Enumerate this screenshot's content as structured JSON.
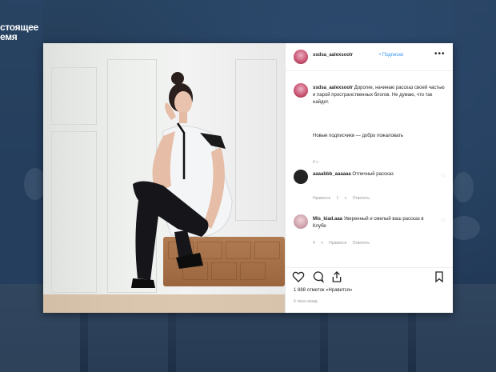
{
  "logo": {
    "line1": "стоящее",
    "line2": "емя"
  },
  "post": {
    "username": "ssdsa_aalexsoolr",
    "follow_label": "• Подписки",
    "more_label": "•••",
    "caption_username": "ssdsa_aalexsoolr",
    "caption_text": "Дорогие, начинаю рассказ своей частью и парой пространственных блогов. Не думаю, что так найдет.",
    "caption_text2": "Новые подписчики — добро пожаловать",
    "caption_time": "4 ч",
    "comments": [
      {
        "username": "aaaabbb_aaaaaa",
        "text": "Отличный рассказ",
        "meta": "Нравится 1 ч Ответить"
      },
      {
        "username": "Mis_kiad.aaa",
        "text": "Уверенный и смелый ваш рассказ в Клубе",
        "meta": "4 ч Нравится Ответить"
      }
    ],
    "likes_text": "1 888 отметок «Нравится»",
    "post_time": "4 часа назад"
  },
  "icons": {
    "heart": "heart-icon",
    "comment": "comment-icon",
    "share": "share-icon",
    "bookmark": "bookmark-icon",
    "avatar": "avatar"
  },
  "colors": {
    "background": "#1f3552",
    "link": "#3897f0",
    "text": "#262626"
  }
}
